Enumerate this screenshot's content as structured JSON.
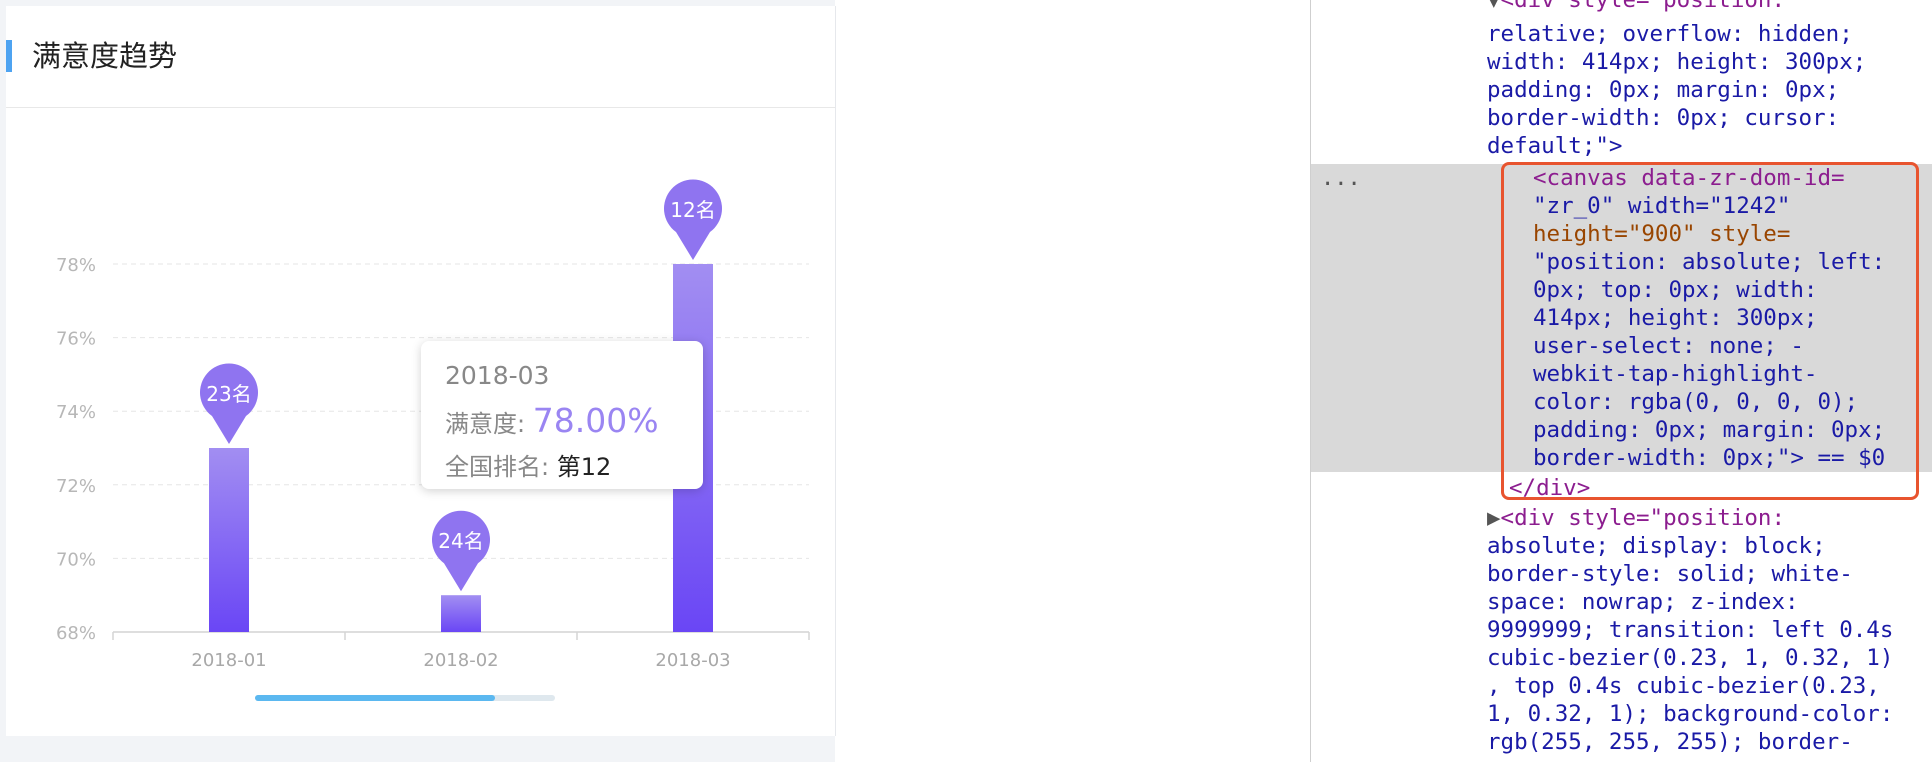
{
  "card": {
    "title": "满意度趋势"
  },
  "chart_data": {
    "type": "bar",
    "categories": [
      "2018-01",
      "2018-02",
      "2018-03"
    ],
    "values": [
      73.0,
      69.0,
      78.0
    ],
    "ranks": [
      "23名",
      "24名",
      "12名"
    ],
    "yticks": [
      "68%",
      "70%",
      "72%",
      "74%",
      "76%",
      "78%"
    ],
    "ylim": [
      68,
      78
    ],
    "title": "",
    "xlabel": "",
    "ylabel": "",
    "grid": true,
    "bar_color_top": "#a28ef2",
    "bar_color_bottom": "#6a46f5",
    "pin_color": "#8f74f0"
  },
  "tooltip": {
    "date": "2018-03",
    "satisfaction_label": "满意度:",
    "satisfaction_value": "78.00%",
    "rank_label": "全国排名:",
    "rank_value": "第12"
  },
  "scrollbar": {
    "progress": 0.8
  },
  "devtools": {
    "lines": [
      "<div style=\"position:",
      "relative; overflow: hidden;",
      "width: 414px; height: 300px;",
      "padding: 0px; margin: 0px;",
      "border-width: 0px; cursor:",
      "default;\">",
      "<canvas data-zr-dom-id=",
      "\"zr_0\" width=\"1242\"",
      "height=\"900\" style=",
      "\"position: absolute; left:",
      "0px; top: 0px; width:",
      "414px; height: 300px;",
      "user-select: none; -",
      "webkit-tap-highlight-",
      "color: rgba(0, 0, 0, 0);",
      "padding: 0px; margin: 0px;",
      "border-width: 0px;\"> == $0",
      "</div>",
      "<div style=\"position:",
      "absolute; display: block;",
      "border-style: solid; white-",
      "space: nowrap; z-index:",
      "9999999; transition: left 0.4s",
      "cubic-bezier(0.23, 1, 0.32, 1)",
      ", top 0.4s cubic-bezier(0.23,",
      "1, 0.32, 1); background-color:",
      "rgb(255, 255, 255); border-"
    ],
    "ellipsis": "..."
  }
}
